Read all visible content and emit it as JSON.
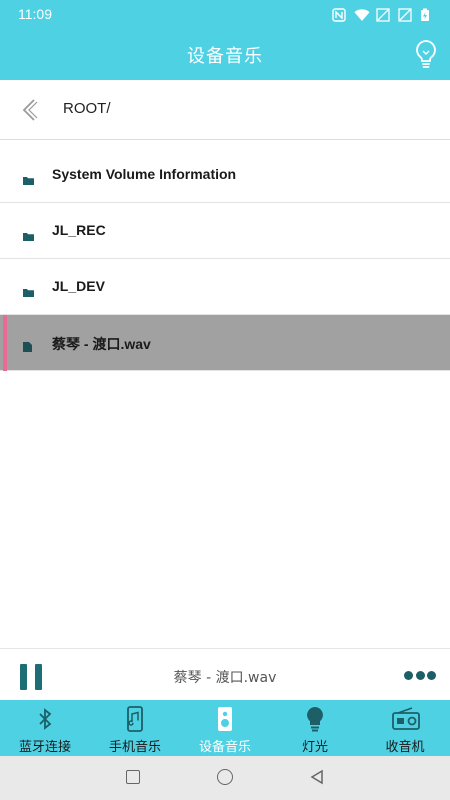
{
  "status_bar": {
    "time": "11:09",
    "icons": [
      "nfc-icon",
      "wifi-icon",
      "signal-no-sim-icon",
      "signal-no-sim-icon",
      "battery-charging-icon"
    ]
  },
  "header": {
    "title": "设备音乐",
    "bulb_icon": "lightbulb-icon"
  },
  "path_bar": {
    "back_icon": "chevron-left-icon",
    "path": "ROOT/"
  },
  "file_list": {
    "items": [
      {
        "name": "System Volume Information",
        "type": "folder",
        "icon": "folder-icon"
      },
      {
        "name": "JL_REC",
        "type": "folder",
        "icon": "folder-icon"
      },
      {
        "name": "JL_DEV",
        "type": "folder",
        "icon": "folder-icon"
      },
      {
        "name": "蔡琴 - 渡口.wav",
        "type": "file",
        "icon": "music-file-icon",
        "selected": true
      }
    ]
  },
  "player": {
    "pause_icon": "pause-icon",
    "now_playing": "蔡琴 - 渡口.wav",
    "more_icon": "more-dots-icon"
  },
  "tabbar": {
    "tabs": [
      {
        "label": "蓝牙连接",
        "icon": "bluetooth-icon",
        "active": false
      },
      {
        "label": "手机音乐",
        "icon": "phone-music-icon",
        "active": false
      },
      {
        "label": "设备音乐",
        "icon": "speaker-icon",
        "active": true
      },
      {
        "label": "灯光",
        "icon": "lightbulb-icon",
        "active": false
      },
      {
        "label": "收音机",
        "icon": "radio-icon",
        "active": false
      }
    ]
  },
  "colors": {
    "accent": "#4fd1e4",
    "selected_row": "#a1a1a1",
    "selected_marker": "#e96a97",
    "icon_dark": "#1d6d74"
  }
}
